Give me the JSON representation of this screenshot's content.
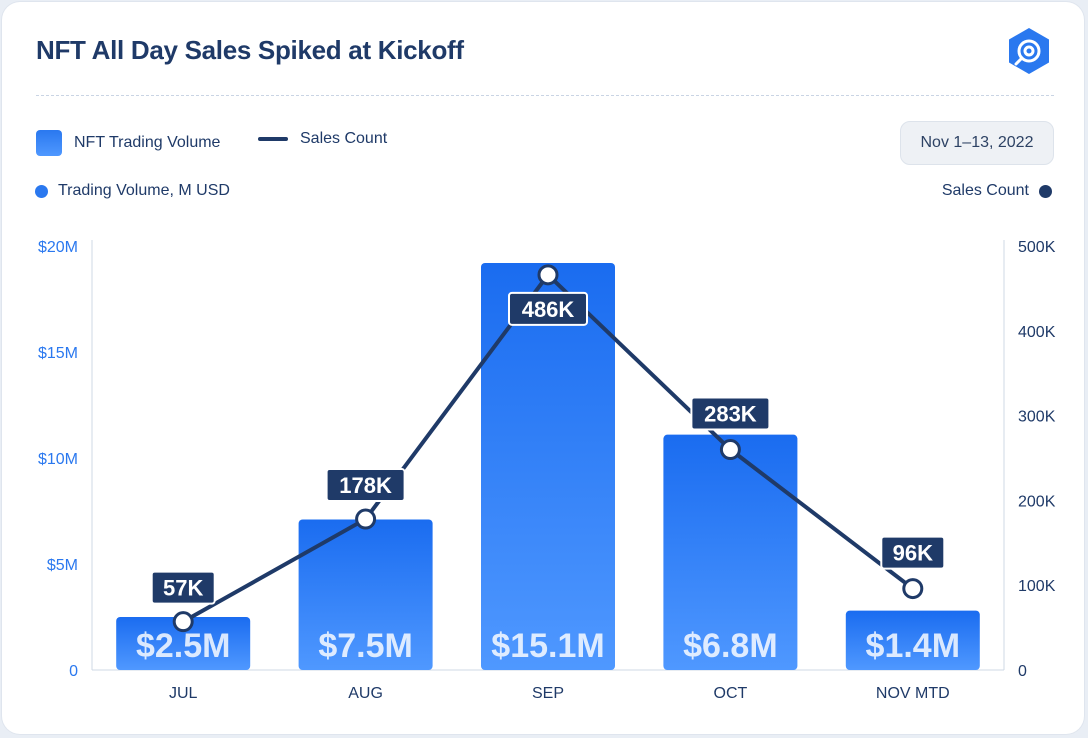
{
  "title": "NFT All Day Sales Spiked at Kickoff",
  "legend": {
    "bars_label": "NFT Trading Volume",
    "line_label": "Sales Count"
  },
  "date_range": "Nov 1–13, 2022",
  "left_axis_caption": "Trading Volume, M USD",
  "right_axis_caption": "Sales Count",
  "colors": {
    "bar_top": "#1a6cf0",
    "bar_bottom": "#4f98ff",
    "line": "#1f3a68",
    "left_axis": "#2a78ef",
    "right_axis": "#1f3a68"
  },
  "icons": {
    "logo": "hexagon-signal-logo-icon"
  },
  "chart_data": {
    "type": "bar",
    "categories": [
      "JUL",
      "AUG",
      "SEP",
      "OCT",
      "NOV MTD"
    ],
    "series": [
      {
        "name": "NFT Trading Volume",
        "axis": "left",
        "type": "bar",
        "values": [
          2.5,
          7.1,
          19.2,
          11.1,
          2.8
        ],
        "labels": [
          "$2.5M",
          "$7.5M",
          "$15.1M",
          "$6.8M",
          "$1.4M"
        ]
      },
      {
        "name": "Sales Count",
        "axis": "right",
        "type": "line",
        "values": [
          57,
          178,
          466,
          260,
          96
        ],
        "labels": [
          "57K",
          "178K",
          "486K",
          "283K",
          "96K"
        ]
      }
    ],
    "ylim_left": [
      0,
      20
    ],
    "ylim_right": [
      0,
      500
    ],
    "yticks_left": [
      "0",
      "$5M",
      "$10M",
      "$15M",
      "$20M"
    ],
    "yticks_right": [
      "0",
      "100K",
      "200K",
      "300K",
      "400K",
      "500K"
    ],
    "grid": false
  }
}
